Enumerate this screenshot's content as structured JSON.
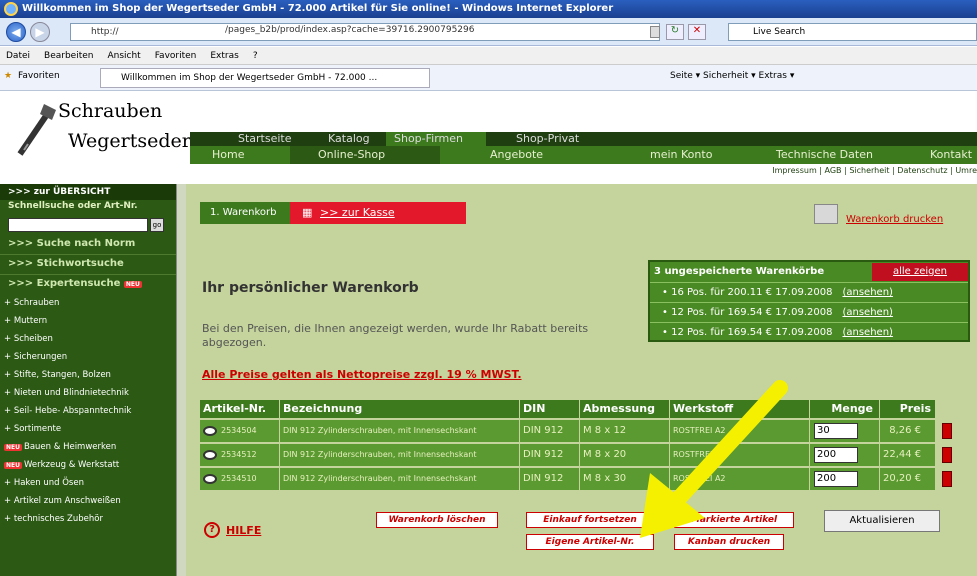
{
  "window": {
    "title": "Willkommen im Shop der Wegertseder GmbH - 72.000 Artikel für Sie online! - Windows Internet Explorer",
    "address": "http://",
    "address_path": "/pages_b2b/prod/index.asp?cache=39716.2900795296",
    "search_placeholder": "Live Search"
  },
  "menu": [
    "Datei",
    "Bearbeiten",
    "Ansicht",
    "Favoriten",
    "Extras",
    "?"
  ],
  "favorites": {
    "label": "Favoriten",
    "tab": "Willkommen im Shop der Wegertseder GmbH - 72.000 ...",
    "tools": "Seite ▾   Sicherheit ▾   Extras ▾"
  },
  "logo": {
    "line1": "Schrauben",
    "line2": "Wegertseder"
  },
  "top_nav": [
    "Startseite",
    "Katalog",
    "Shop-Firmen",
    "Shop-Privat"
  ],
  "main_nav": [
    "Home",
    "Online-Shop",
    "Angebote",
    "mein Konto",
    "Technische Daten",
    "Kontakt"
  ],
  "impressum": "Impressum | AGB | Sicherheit | Datenschutz | Umre",
  "sidebar": {
    "top": ">>> zur ÜBERSICHT",
    "quick": "Schnellsuche oder Art-Nr.",
    "go": "go",
    "links": [
      ">>> Suche nach Norm",
      ">>> Stichwortsuche",
      ">>> Expertensuche"
    ],
    "neu": "NEU",
    "items": [
      "Schrauben",
      "Muttern",
      "Scheiben",
      "Sicherungen",
      "Stifte, Stangen, Bolzen",
      "Nieten und Blindnietechnik",
      "Seil- Hebe- Abspanntechnik",
      "Sortimente",
      "Bauen & Heimwerken",
      "Werkzeug & Werkstatt",
      "Haken und Ösen",
      "Artikel zum Anschweißen",
      "technisches Zubehör"
    ]
  },
  "cart": {
    "tab": "1. Warenkorb",
    "checkout": ">> zur Kasse",
    "print": "Warenkorb drucken",
    "heading": "Ihr persönlicher Warenkorb",
    "desc": "Bei den Preisen, die Ihnen angezeigt werden, wurde Ihr Rabatt bereits abgezogen.",
    "netto": "Alle Preise gelten als Nettopreise zzgl. 19 % MWST."
  },
  "saved": {
    "head": "3 ungespeicherte Warenkörbe",
    "show_all": "alle zeigen",
    "rows": [
      {
        "text": "• 16 Pos. für 200.11 €   17.09.2008",
        "link": "(ansehen)"
      },
      {
        "text": "• 12 Pos. für 169.54 €   17.09.2008",
        "link": "(ansehen)"
      },
      {
        "text": "• 12 Pos. für 169.54 €   17.09.2008",
        "link": "(ansehen)"
      }
    ]
  },
  "table": {
    "headers": [
      "Artikel-Nr.",
      "Bezeichnung",
      "DIN",
      "Abmessung",
      "Werkstoff",
      "Menge",
      "Preis"
    ],
    "rows": [
      {
        "art": "2534504",
        "bez": "DIN 912 Zylinderschrauben, mit Innensechskant",
        "din": "DIN 912",
        "abm": "M 8 x 12",
        "werk": "ROSTFREI A2",
        "qty": "30",
        "price": "8,26 €"
      },
      {
        "art": "2534512",
        "bez": "DIN 912 Zylinderschrauben, mit Innensechskant",
        "din": "DIN 912",
        "abm": "M 8 x 20",
        "werk": "ROSTFREI A2",
        "qty": "200",
        "price": "22,44 €"
      },
      {
        "art": "2534510",
        "bez": "DIN 912 Zylinderschrauben, mit Innensechskant",
        "din": "DIN 912",
        "abm": "M 8 x 30",
        "werk": "ROSTFREI A2",
        "qty": "200",
        "price": "20,20 €"
      }
    ]
  },
  "actions": {
    "clear": "Warenkorb löschen",
    "continue": "Einkauf fortsetzen",
    "selected": "Markierte Artikel",
    "own_nr": "Eigene Artikel-Nr.",
    "kanban": "Kanban drucken",
    "update": "Aktualisieren",
    "help": "HILFE"
  },
  "colors": {
    "arrow": "#f5f000",
    "accent_red": "#e3182a",
    "nav_green": "#3d7a1e"
  }
}
